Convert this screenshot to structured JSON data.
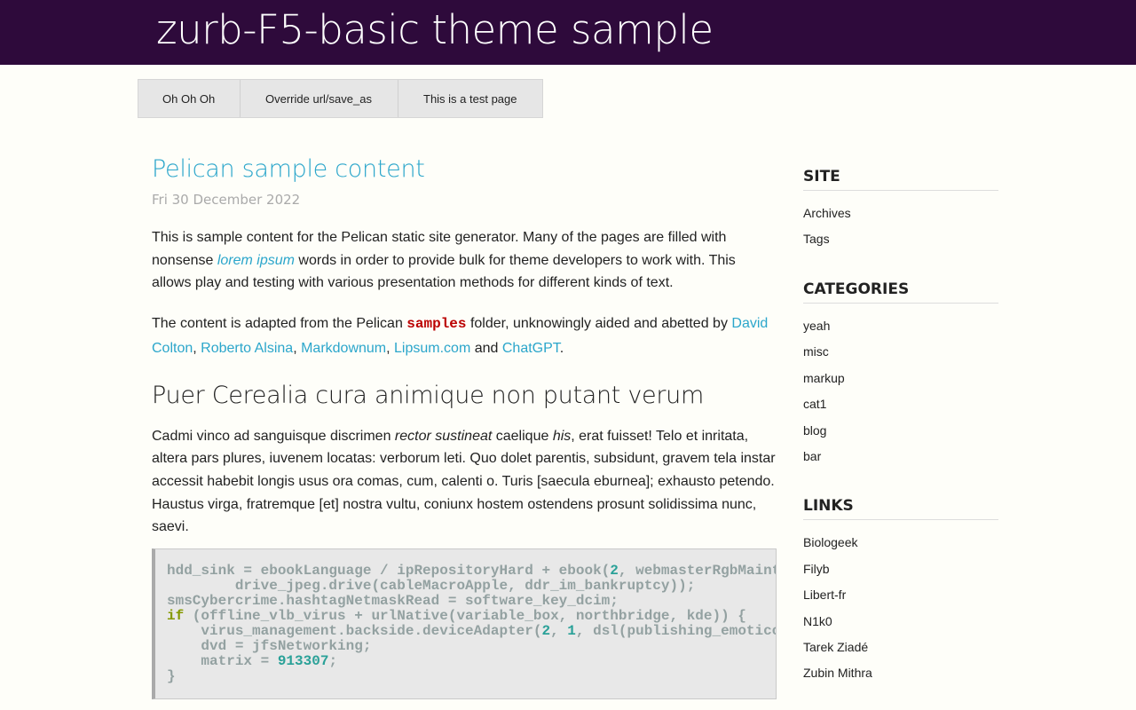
{
  "header": {
    "site_title": "zurb-F5-basic theme sample"
  },
  "nav": {
    "items": [
      {
        "label": "Oh Oh Oh"
      },
      {
        "label": "Override url/save_as"
      },
      {
        "label": "This is a test page"
      }
    ]
  },
  "article": {
    "title": "Pelican sample content",
    "date": "Fri 30 December 2022",
    "p1": {
      "t1": "This is sample content for the Pelican static site generator. Many of the pages are filled with nonsense ",
      "link": "lorem ipsum",
      "t2": " words in order to provide bulk for theme developers to work with. This allows play and testing with various presentation methods for different kinds of text."
    },
    "p2": {
      "t1": "The content is adapted from the Pelican ",
      "code": "samples",
      "t2": " folder, unknowingly aided and abetted by ",
      "link1": "David Colton",
      "sep1": ", ",
      "link2": "Roberto Alsina",
      "sep2": ", ",
      "link3": "Markdownum",
      "sep3": ", ",
      "link4": "Lipsum.com",
      "and": " and ",
      "link5": "ChatGPT",
      "end": "."
    },
    "h2": "Puer Cerealia cura animique non putant verum",
    "p3": {
      "t1": "Cadmi vinco ad sanguisque discrimen ",
      "em1": "rector sustineat",
      "t2": " caelique ",
      "em2": "his",
      "t3": ", erat fuisset! Telo et inritata, altera pars plures, iuvenem locatas: verborum leti. Quo dolet parentis, subsidunt, gravem tela instar accessit habebit longis usus ora comas, cum, calenti o. Turis [saecula eburnea]; exhausto petendo. Haustus virga, fratremque [et] nostra vultu, coniunx hostem ostendens prosunt solidissima nunc, saevi."
    },
    "code": {
      "l1a": "hdd_sink = ebookLanguage / ipRepositoryHard + ebook(",
      "l1n": "2",
      "l1b": ", webmasterRgbMaint",
      "l2": "        drive_jpeg.drive(cableMacroApple, ddr_im_bankruptcy));",
      "l3": "smsCybercrime.hashtagNetmaskRead = software_key_dcim;",
      "l4kw": "if",
      "l4": " (offline_vlb_virus + urlNative(variable_box, northbridge, kde)) {",
      "l5a": "    virus_management.backside.deviceAdapter(",
      "l5n1": "2",
      "l5b": ", ",
      "l5n2": "1",
      "l5c": ", dsl(publishing_emoticon",
      "l6": "    dvd = jfsNetworking;",
      "l7a": "    matrix = ",
      "l7n": "913307",
      "l7b": ";",
      "l8": "}"
    }
  },
  "sidebar": {
    "site": {
      "heading": "SITE",
      "links": [
        "Archives",
        "Tags"
      ]
    },
    "categories": {
      "heading": "CATEGORIES",
      "links": [
        "yeah",
        "misc",
        "markup",
        "cat1",
        "blog",
        "bar"
      ]
    },
    "links": {
      "heading": "LINKS",
      "links": [
        "Biologeek",
        "Filyb",
        "Libert-fr",
        "N1k0",
        "Tarek Ziadé",
        "Zubin Mithra"
      ]
    }
  }
}
